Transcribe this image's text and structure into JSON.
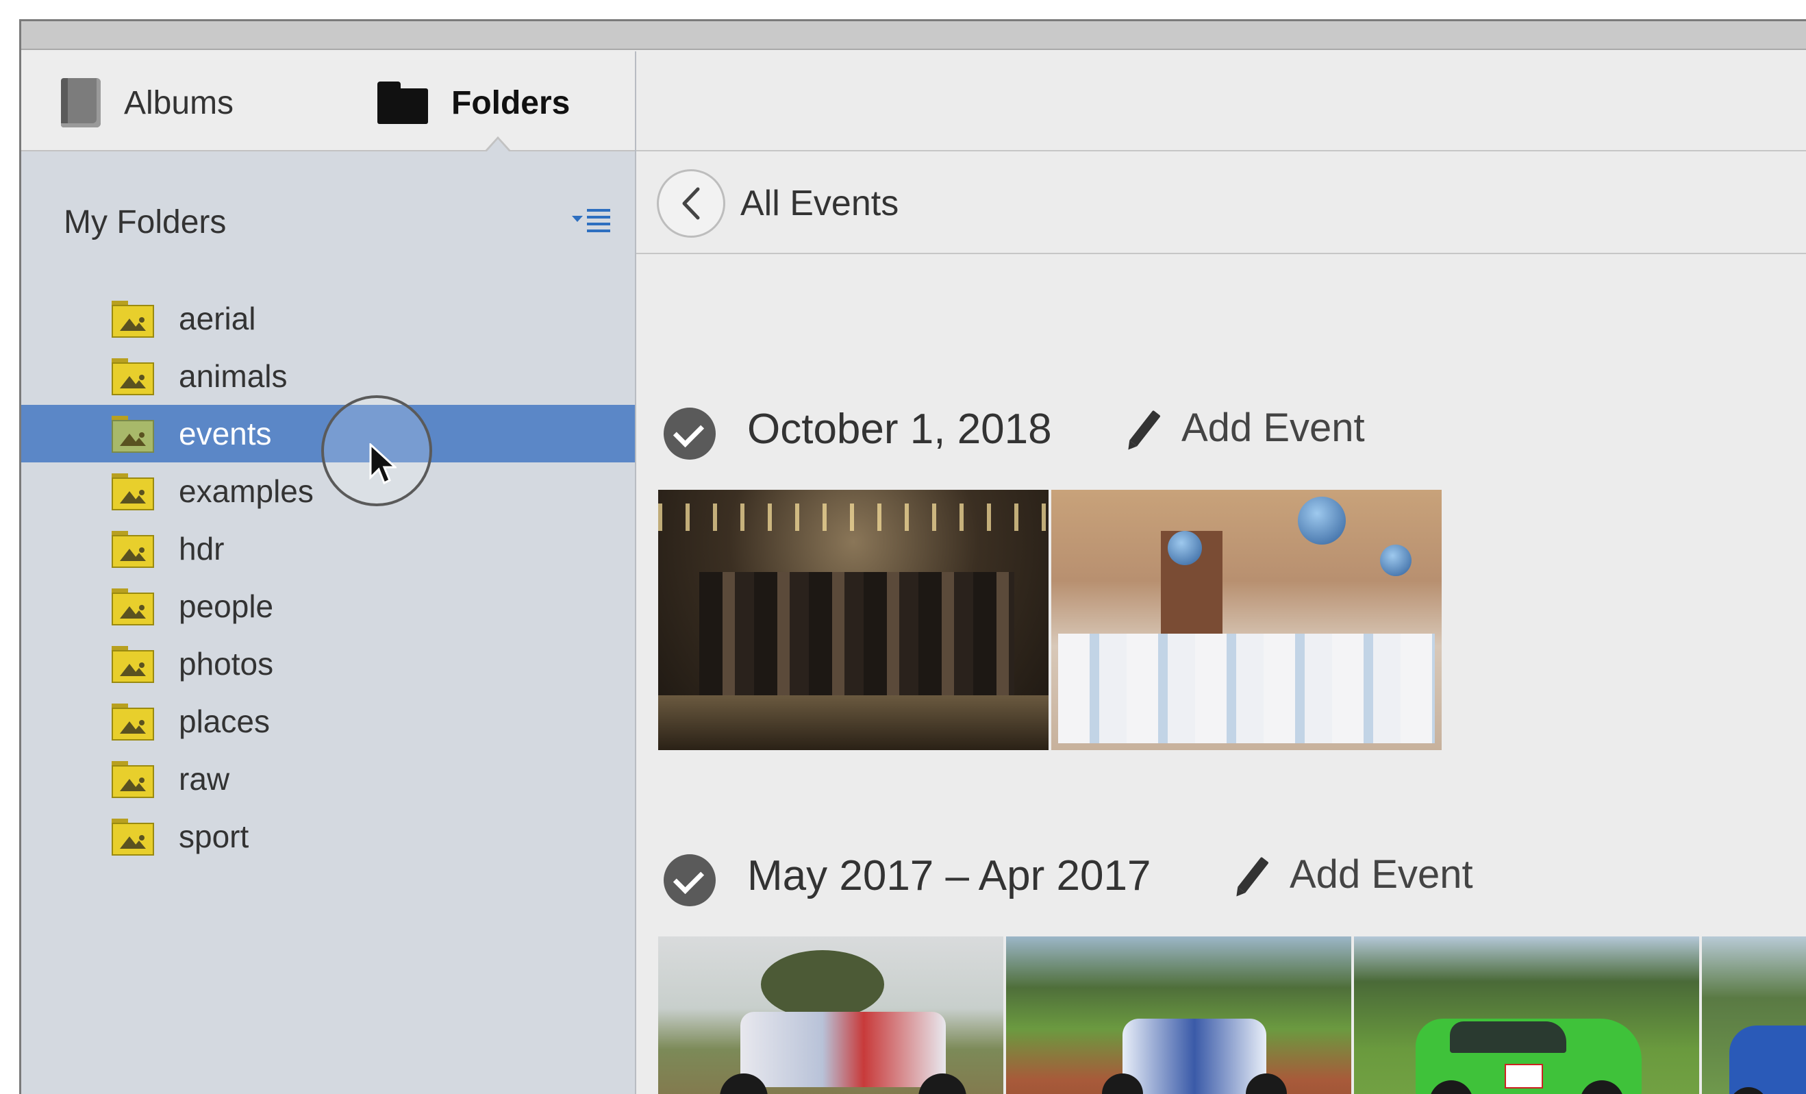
{
  "tabs": [
    {
      "label": "Albums",
      "icon": "book-icon"
    },
    {
      "label": "Folders",
      "icon": "folder-icon"
    }
  ],
  "sidebar": {
    "section_title": "My Folders",
    "folders": [
      {
        "label": "aerial"
      },
      {
        "label": "animals"
      },
      {
        "label": "events",
        "selected": true
      },
      {
        "label": "examples"
      },
      {
        "label": "hdr"
      },
      {
        "label": "people"
      },
      {
        "label": "photos"
      },
      {
        "label": "places"
      },
      {
        "label": "raw"
      },
      {
        "label": "sport"
      }
    ]
  },
  "nav": {
    "back_icon": "chevron-left-icon",
    "title": "All Events"
  },
  "events": [
    {
      "date": "October 1, 2018",
      "add_label": "Add Event",
      "photo_count": 2
    },
    {
      "date": "May 2017 – Apr 2017",
      "add_label": "Add Event",
      "photo_count": 4
    }
  ],
  "colors": {
    "selection": "#5b87c7",
    "sidebar_bg": "#d4d9e0",
    "folder_yellow": "#e8cf2c"
  }
}
